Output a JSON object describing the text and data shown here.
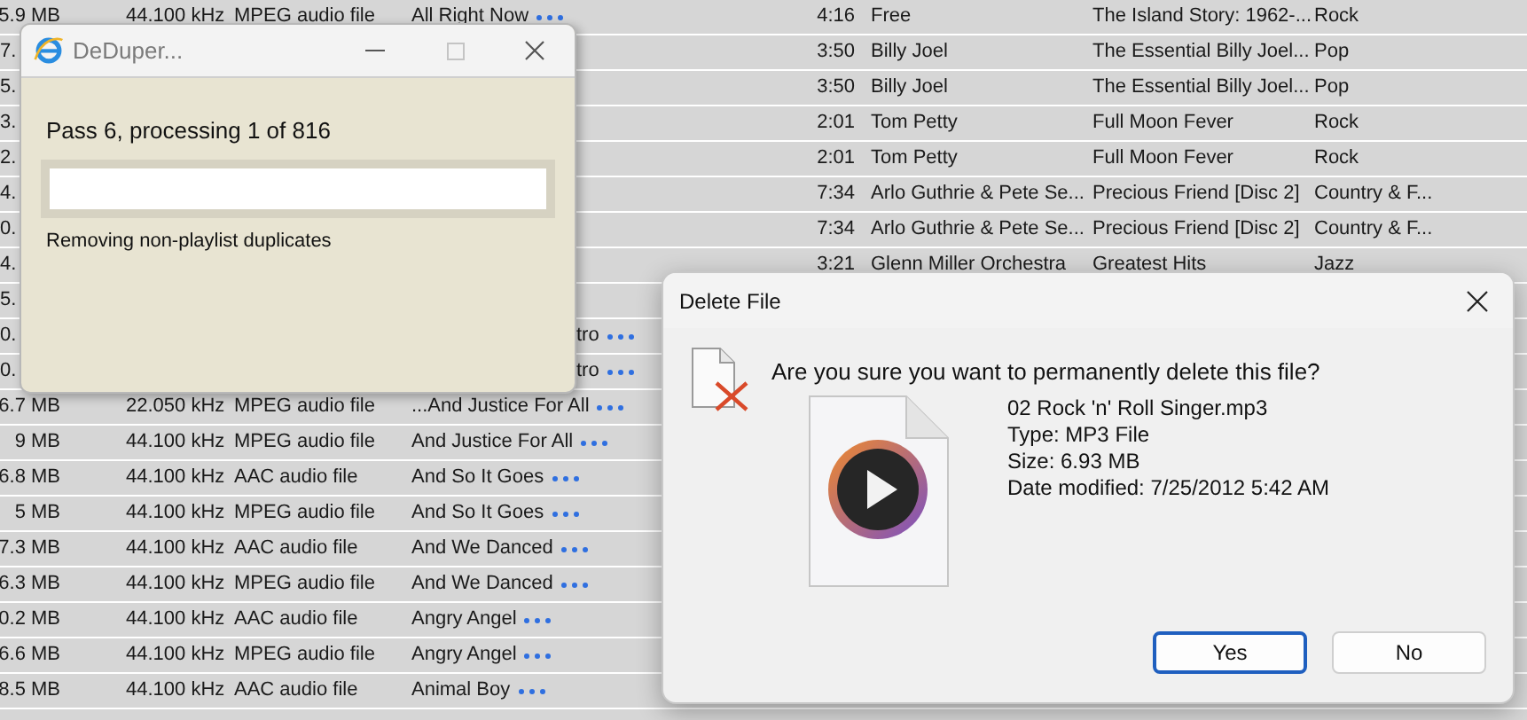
{
  "table": {
    "rows": [
      {
        "kind": "full",
        "size": "5.9 MB",
        "rate": "44.100 kHz",
        "type": "MPEG audio file",
        "name": "All Right Now",
        "more": true,
        "time": "4:16",
        "artist": "Free",
        "album": "The Island Story: 1962-...",
        "genre": "Rock"
      },
      {
        "kind": "covered",
        "size": "7.",
        "time": "3:50",
        "artist": "Billy Joel",
        "album": "The Essential Billy Joel...",
        "genre": "Pop"
      },
      {
        "kind": "covered",
        "size": "5.",
        "time": "3:50",
        "artist": "Billy Joel",
        "album": "The Essential Billy Joel...",
        "genre": "Pop"
      },
      {
        "kind": "covered",
        "size": "3.",
        "time": "2:01",
        "artist": "Tom Petty",
        "album": "Full Moon Fever",
        "genre": "Rock"
      },
      {
        "kind": "covered",
        "size": "2.",
        "time": "2:01",
        "artist": "Tom Petty",
        "album": "Full Moon Fever",
        "genre": "Rock"
      },
      {
        "kind": "covered",
        "size": "4.",
        "time": "7:34",
        "artist": "Arlo Guthrie & Pete Se...",
        "album": "Precious Friend [Disc 2]",
        "genre": "Country & F..."
      },
      {
        "kind": "covered",
        "size": "0.",
        "time": "7:34",
        "artist": "Arlo Guthrie & Pete Se...",
        "album": "Precious Friend [Disc 2]",
        "genre": "Country & F..."
      },
      {
        "kind": "covered",
        "size": "4.",
        "time": "3:21",
        "artist": "Glenn Miller Orchestra",
        "album": "Greatest Hits",
        "genre": "Jazz"
      },
      {
        "kind": "covered",
        "size": "5."
      },
      {
        "kind": "covered",
        "size": "0.",
        "name": "tro",
        "more": true
      },
      {
        "kind": "covered",
        "size": "0.",
        "name": "tro",
        "more": true
      },
      {
        "kind": "full",
        "size": "6.7 MB",
        "rate": "22.050 kHz",
        "type": "MPEG audio file",
        "name": "...And Justice For All",
        "more": true
      },
      {
        "kind": "full",
        "size": "9 MB",
        "rate": "44.100 kHz",
        "type": "MPEG audio file",
        "name": "And Justice For All",
        "more": true
      },
      {
        "kind": "full",
        "size": "6.8 MB",
        "rate": "44.100 kHz",
        "type": "AAC audio file",
        "name": "And So It Goes",
        "more": true
      },
      {
        "kind": "full",
        "size": "5 MB",
        "rate": "44.100 kHz",
        "type": "MPEG audio file",
        "name": "And So It Goes",
        "more": true
      },
      {
        "kind": "full",
        "size": "7.3 MB",
        "rate": "44.100 kHz",
        "type": "AAC audio file",
        "name": "And We Danced",
        "more": true
      },
      {
        "kind": "full",
        "size": "6.3 MB",
        "rate": "44.100 kHz",
        "type": "MPEG audio file",
        "name": "And We Danced",
        "more": true
      },
      {
        "kind": "full",
        "size": "0.2 MB",
        "rate": "44.100 kHz",
        "type": "AAC audio file",
        "name": "Angry Angel",
        "more": true
      },
      {
        "kind": "full",
        "size": "6.6 MB",
        "rate": "44.100 kHz",
        "type": "MPEG audio file",
        "name": "Angry Angel",
        "more": true
      },
      {
        "kind": "full",
        "size": "8.5 MB",
        "rate": "44.100 kHz",
        "type": "AAC audio file",
        "name": "Animal Boy",
        "more": true
      }
    ]
  },
  "progress_window": {
    "title": "DeDuper...",
    "status": "Pass 6, processing 1 of 816",
    "progress": {
      "level": 0
    },
    "detail": "Removing non-playlist duplicates"
  },
  "delete_dialog": {
    "title": "Delete File",
    "question": "Are you sure you want to permanently delete this file?",
    "file_lines": [
      "02 Rock 'n' Roll Singer.mp3",
      "Type: MP3 File",
      "Size: 6.93 MB",
      "Date modified: 7/25/2012 5:42 AM"
    ],
    "buttons": [
      {
        "label": "Yes",
        "selected": true
      },
      {
        "label": "No",
        "selected": false
      }
    ]
  }
}
